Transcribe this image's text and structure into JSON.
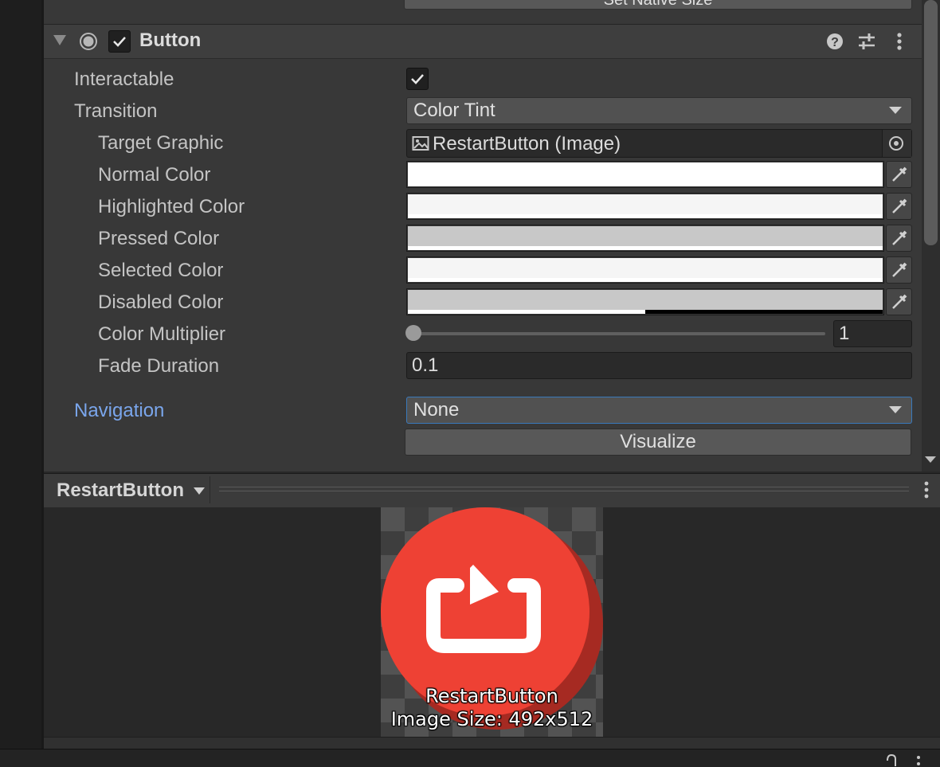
{
  "top_button_label": "Set Native Size",
  "component": {
    "title": "Button",
    "enabled": true,
    "icons": [
      "help-icon",
      "presets-icon",
      "more-icon"
    ]
  },
  "fields": {
    "interactable": {
      "label": "Interactable",
      "checked": true
    },
    "transition": {
      "label": "Transition",
      "value": "Color Tint"
    },
    "target_graphic": {
      "label": "Target Graphic",
      "value": "RestartButton (Image)"
    },
    "normal_color": {
      "label": "Normal Color",
      "color": "#ffffff",
      "alpha": 1.0
    },
    "highlighted_color": {
      "label": "Highlighted Color",
      "color": "#f5f5f5",
      "alpha": 1.0
    },
    "pressed_color": {
      "label": "Pressed Color",
      "color": "#c8c8c8",
      "alpha": 1.0
    },
    "selected_color": {
      "label": "Selected Color",
      "color": "#f5f5f5",
      "alpha": 1.0
    },
    "disabled_color": {
      "label": "Disabled Color",
      "color": "#c8c8c8",
      "alpha": 0.5
    },
    "color_multiplier": {
      "label": "Color Multiplier",
      "value": "1",
      "slider_fraction": 0.0
    },
    "fade_duration": {
      "label": "Fade Duration",
      "value": "0.1"
    },
    "navigation": {
      "label": "Navigation",
      "value": "None"
    },
    "visualize_label": "Visualize"
  },
  "preview": {
    "title": "RestartButton",
    "image_name": "RestartButton",
    "image_size": "Image Size: 492x512",
    "accent": "#ee4134"
  }
}
